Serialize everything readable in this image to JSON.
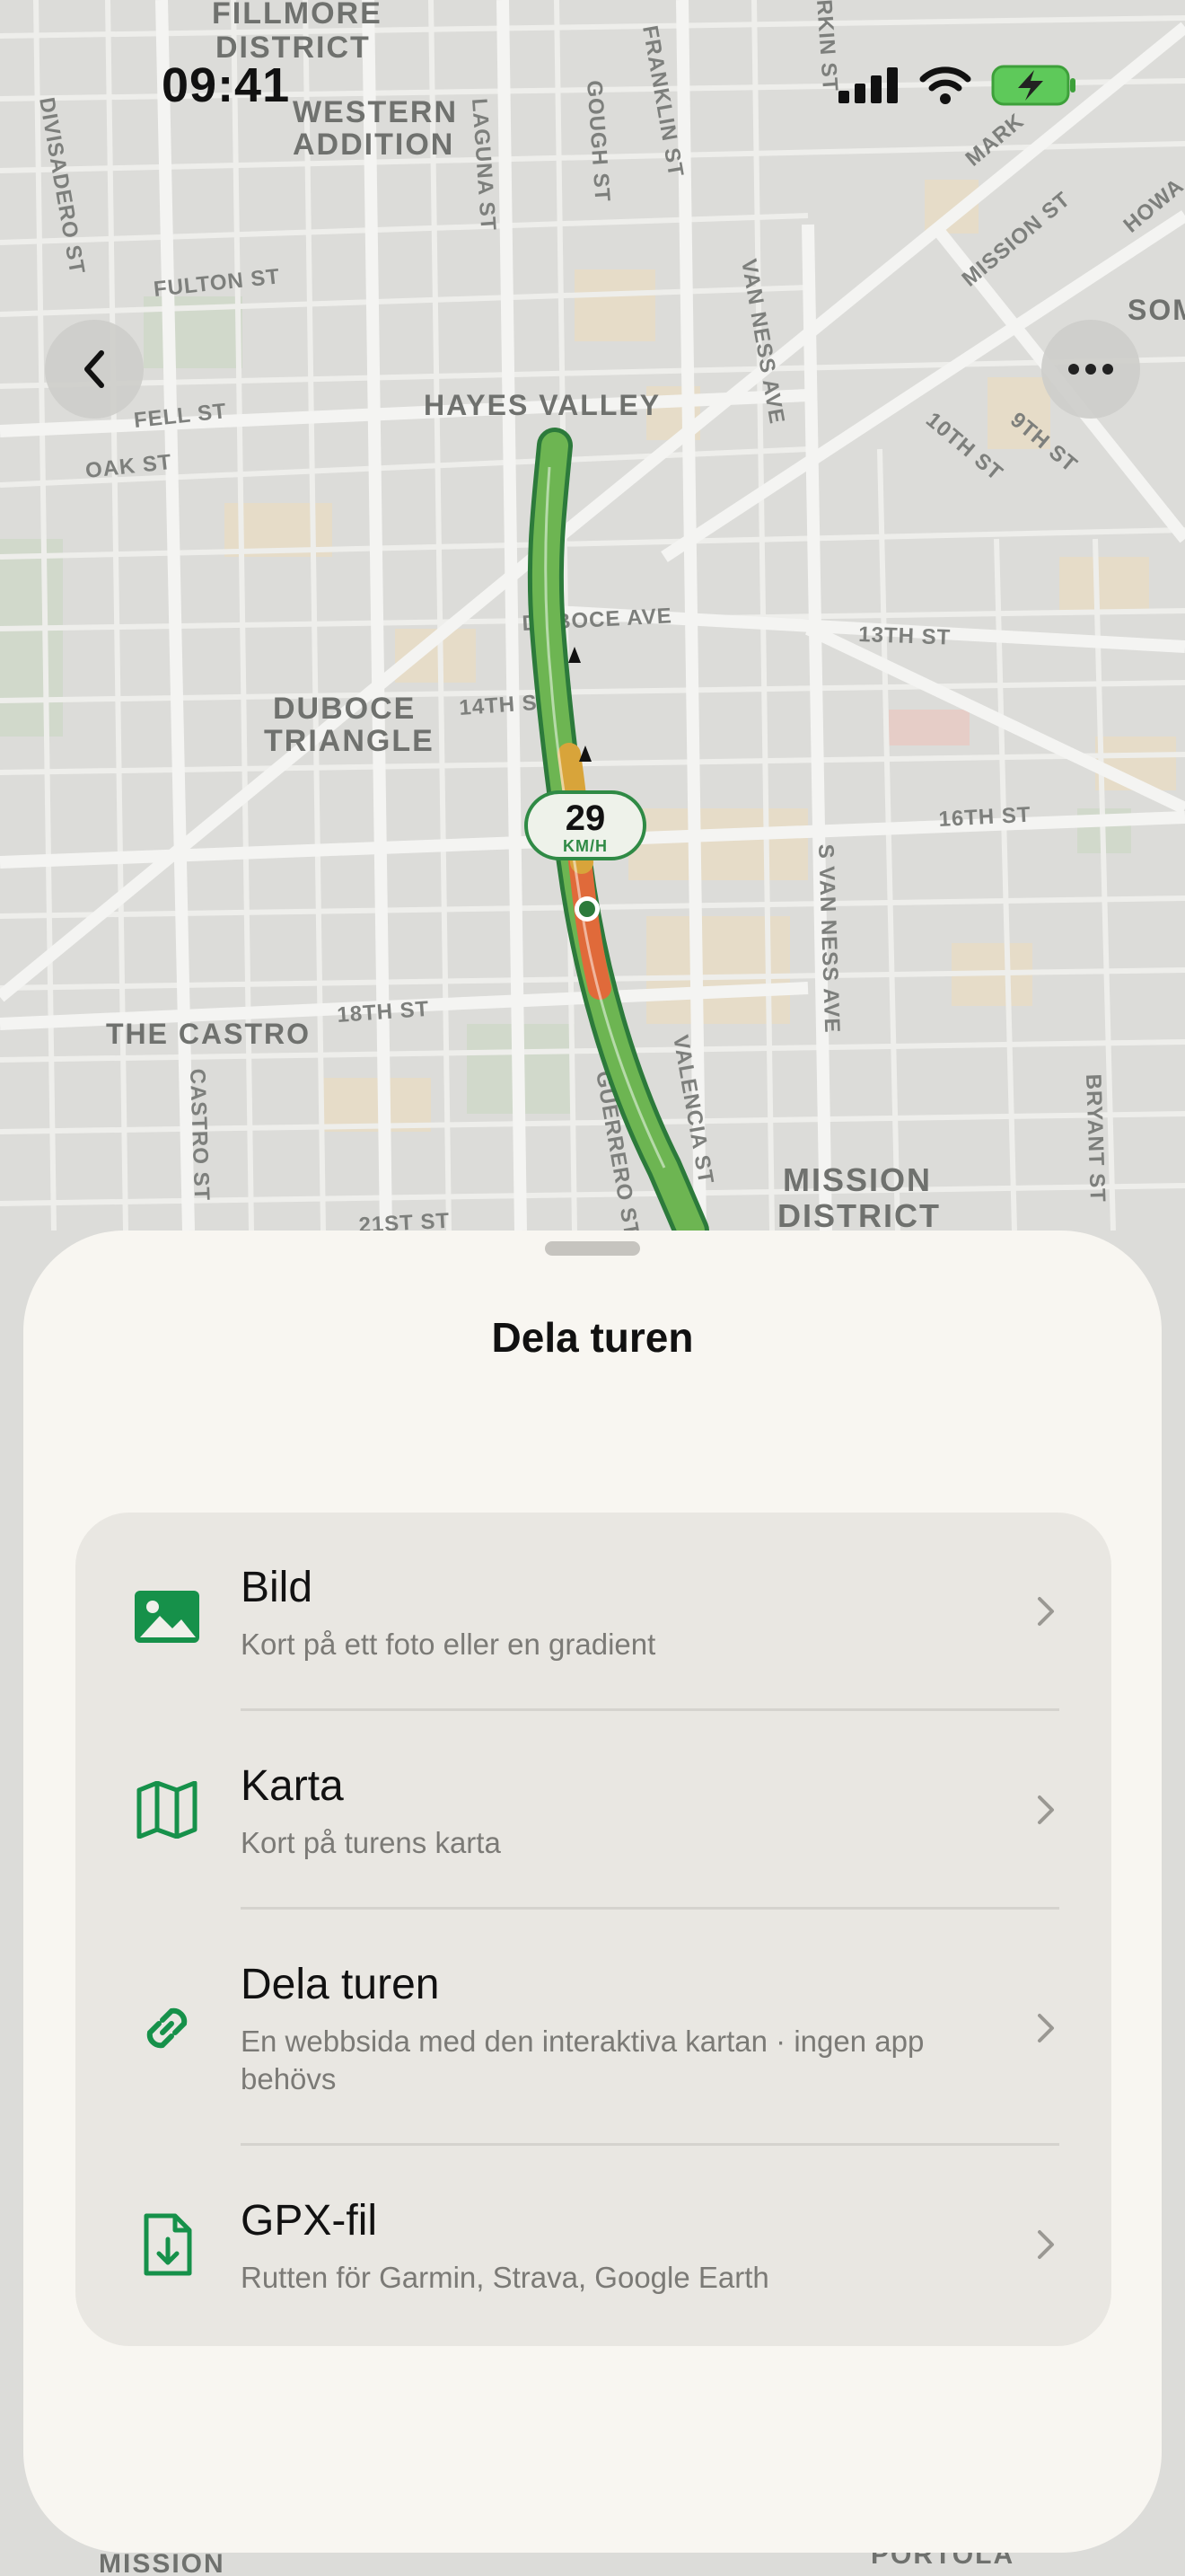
{
  "status_bar": {
    "time": "09:41"
  },
  "map": {
    "area_labels": {
      "fillmore1": "FILLMORE",
      "fillmore2": "DISTRICT",
      "western1": "WESTERN",
      "western2": "ADDITION",
      "hayes": "HAYES VALLEY",
      "duboce1": "DUBOCE",
      "duboce2": "TRIANGLE",
      "castro": "THE CASTRO",
      "mission1": "MISSION",
      "mission2": "DISTRICT",
      "som": "SOM",
      "mission_bottom": "MISSION",
      "portola": "PORTOLA"
    },
    "street_labels": {
      "divisadero": "DIVISADERO ST",
      "fulton": "FULTON ST",
      "fell": "FELL ST",
      "oak": "OAK ST",
      "laguna": "LAGUNA ST",
      "gough": "GOUGH ST",
      "franklin": "FRANKLIN ST",
      "rkin": "RKIN ST",
      "mark": "MARK",
      "mission_st": "MISSION ST",
      "howa": "HOWA",
      "van_ness": "VAN NESS AVE",
      "tenth": "10TH ST",
      "ninth": "9TH ST",
      "duboce_ave": "DUBOCE AVE",
      "thirteenth": "13TH ST",
      "fourteenth": "14TH ST",
      "sixteenth": "16TH ST",
      "s_van_ness": "S VAN NESS AVE",
      "eighteenth": "18TH ST",
      "castro_st": "CASTRO ST",
      "guerrero": "GUERRERO ST",
      "valencia": "VALENCIA ST",
      "bryant": "BRYANT ST",
      "twentyfirst": "21ST ST"
    },
    "speed": {
      "value": "29",
      "unit": "KM/H"
    }
  },
  "controls": {
    "back_icon": "chevron-left-icon",
    "more_icon": "ellipsis-icon"
  },
  "sheet": {
    "title": "Dela turen",
    "accent_color": "#16914a",
    "options": [
      {
        "icon": "image-icon",
        "title": "Bild",
        "subtitle": "Kort på ett foto eller en gradient"
      },
      {
        "icon": "map-icon",
        "title": "Karta",
        "subtitle": "Kort på turens karta"
      },
      {
        "icon": "link-icon",
        "title": "Dela turen",
        "subtitle": "En webbsida med den interaktiva kartan · ingen app behövs"
      },
      {
        "icon": "file-download-icon",
        "title": "GPX-fil",
        "subtitle": "Rutten för Garmin, Strava, Google Earth"
      }
    ]
  }
}
